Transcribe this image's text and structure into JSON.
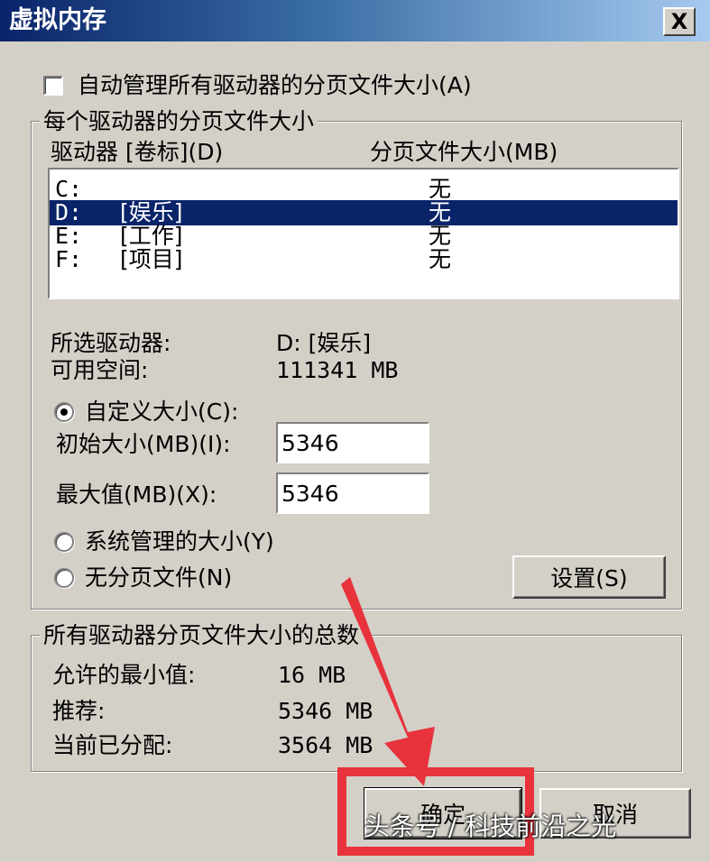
{
  "window": {
    "title": "虚拟内存",
    "close_glyph": "X"
  },
  "auto_manage": {
    "label": "自动管理所有驱动器的分页文件大小(A)",
    "checked": false
  },
  "per_drive_group": {
    "title": "每个驱动器的分页文件大小",
    "col_drive": "驱动器 [卷标](D)",
    "col_size": "分页文件大小(MB)",
    "drives": [
      {
        "letter": "C:",
        "label": "",
        "size": "无",
        "selected": false
      },
      {
        "letter": "D:",
        "label": "[娱乐]",
        "size": "无",
        "selected": true
      },
      {
        "letter": "E:",
        "label": "[工作]",
        "size": "无",
        "selected": false
      },
      {
        "letter": "F:",
        "label": "[项目]",
        "size": "无",
        "selected": false
      }
    ],
    "selected_drive_label": "所选驱动器:",
    "selected_drive_value": "D:  [娱乐]",
    "free_space_label": "可用空间:",
    "free_space_value": "111341 MB",
    "custom_size_label": "自定义大小(C):",
    "initial_size_label": "初始大小(MB)(I):",
    "initial_size_value": "5346",
    "max_size_label": "最大值(MB)(X):",
    "max_size_value": "5346",
    "system_managed_label": "系统管理的大小(Y)",
    "no_paging_label": "无分页文件(N)",
    "selected_option": "custom",
    "set_button": "设置(S)"
  },
  "totals_group": {
    "title": "所有驱动器分页文件大小的总数",
    "min_label": "允许的最小值:",
    "min_value": "16 MB",
    "recommended_label": "推荐:",
    "recommended_value": "5346 MB",
    "allocated_label": "当前已分配:",
    "allocated_value": "3564 MB"
  },
  "buttons": {
    "ok": "确定",
    "cancel": "取消"
  },
  "annotation": {
    "color": "#e8323c",
    "watermark": "头条号 / 科技前沿之光"
  }
}
